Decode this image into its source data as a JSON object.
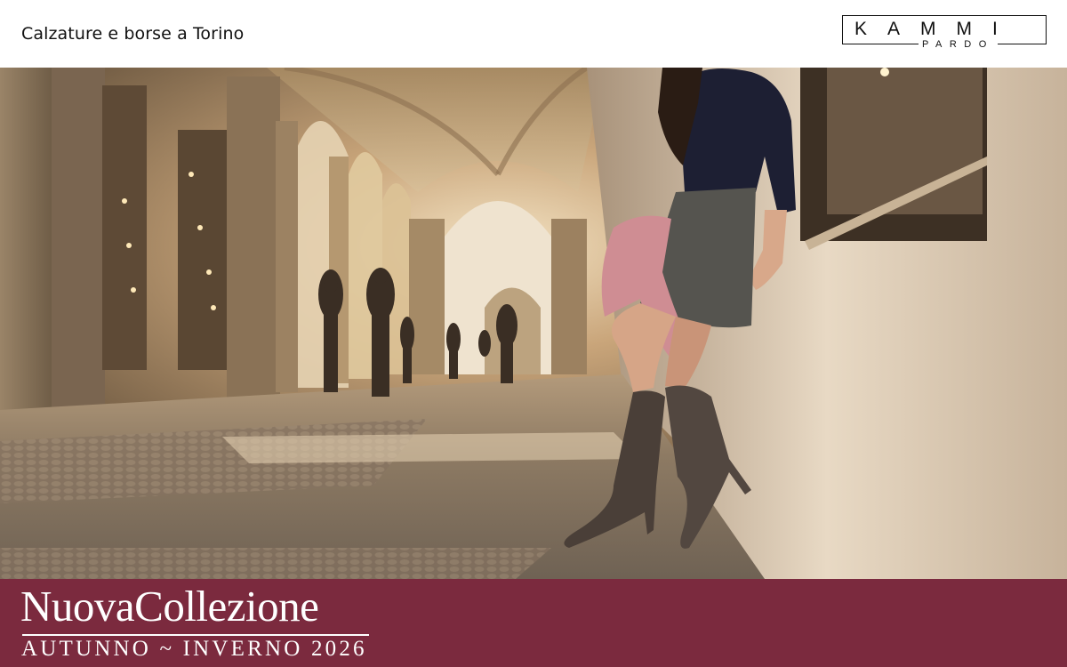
{
  "header": {
    "tagline": "Calzature e borse a Torino",
    "logo": {
      "main": "KAMMI",
      "sub": "PARDO"
    }
  },
  "hero": {
    "description_icon": "photo-woman-boots-arcade"
  },
  "banner": {
    "title_part1": "Nuova",
    "title_part2": "Collezione",
    "subtitle": "AUTUNNO ~ INVERNO 2026"
  },
  "colors": {
    "banner_bg": "#7b2a3e",
    "text_dark": "#111111",
    "text_light": "#ffffff"
  }
}
